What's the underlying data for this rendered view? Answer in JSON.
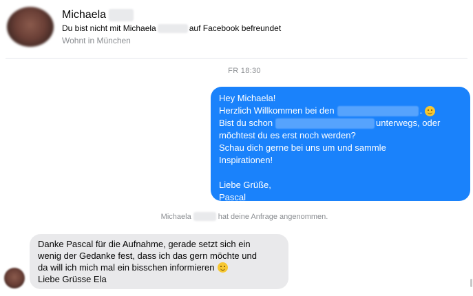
{
  "header": {
    "name": "Michaela",
    "friend_text_pre": "Du bist nicht mit Michaela",
    "friend_text_post": "auf Facebook befreundet",
    "location": "Wohnt in München"
  },
  "timestamp": "FR 18:30",
  "outgoing_message": {
    "line1": "Hey Michaela!",
    "line2_pre": "Herzlich Willkommen bei den",
    "line2_post": ".",
    "line3_pre": "Bist du schon",
    "line3_post": "unterwegs, oder",
    "line4": "möchtest du es erst noch werden?",
    "line5": "Schau dich gerne bei uns um und sammle",
    "line6": "Inspirationen!",
    "line7": "Liebe Grüße,",
    "line8": "Pascal"
  },
  "system_message": {
    "pre": "Michaela",
    "post": "hat deine Anfrage angenommen."
  },
  "incoming_message": {
    "line1": "Danke Pascal für die Aufnahme, gerade setzt sich ein",
    "line2": "wenig der Gedanke fest, dass ich das gern möchte und",
    "line3": "da will ich mich mal ein bisschen informieren",
    "line4": "Liebe Grüsse Ela"
  },
  "icons": {
    "emoji": "smiley-icon"
  }
}
